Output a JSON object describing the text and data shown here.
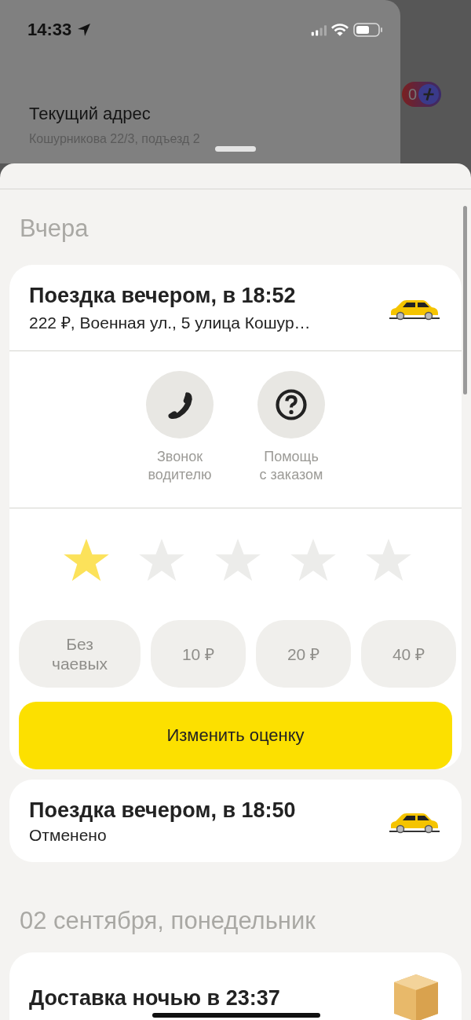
{
  "status_bar": {
    "time": "14:33"
  },
  "background": {
    "title": "Текущий адрес",
    "subtitle": "Кошурникова 22/3, подъезд 2",
    "badge": "0"
  },
  "sections": [
    {
      "heading": "Вчера",
      "orders": [
        {
          "kind": "ride",
          "title": "Поездка вечером, в 18:52",
          "subtitle": "222 ₽, Военная ул., 5 улица Кошур…",
          "expanded": true,
          "actions": [
            {
              "kind": "phone",
              "label": "Звонок\nводителю"
            },
            {
              "kind": "help",
              "label": "Помощь\nс заказом"
            }
          ],
          "stars": 1,
          "tips": [
            {
              "label": "Без\nчаевых"
            },
            {
              "label": "10 ₽"
            },
            {
              "label": "20 ₽"
            },
            {
              "label": "40 ₽"
            }
          ],
          "button": "Изменить оценку"
        },
        {
          "kind": "ride",
          "title": "Поездка вечером, в 18:50",
          "subtitle": "Отменено",
          "expanded": false
        }
      ]
    },
    {
      "heading": "02 сентября, понедельник",
      "orders": [
        {
          "kind": "delivery",
          "title": "Доставка ночью в 23:37",
          "expanded": false
        }
      ]
    }
  ]
}
